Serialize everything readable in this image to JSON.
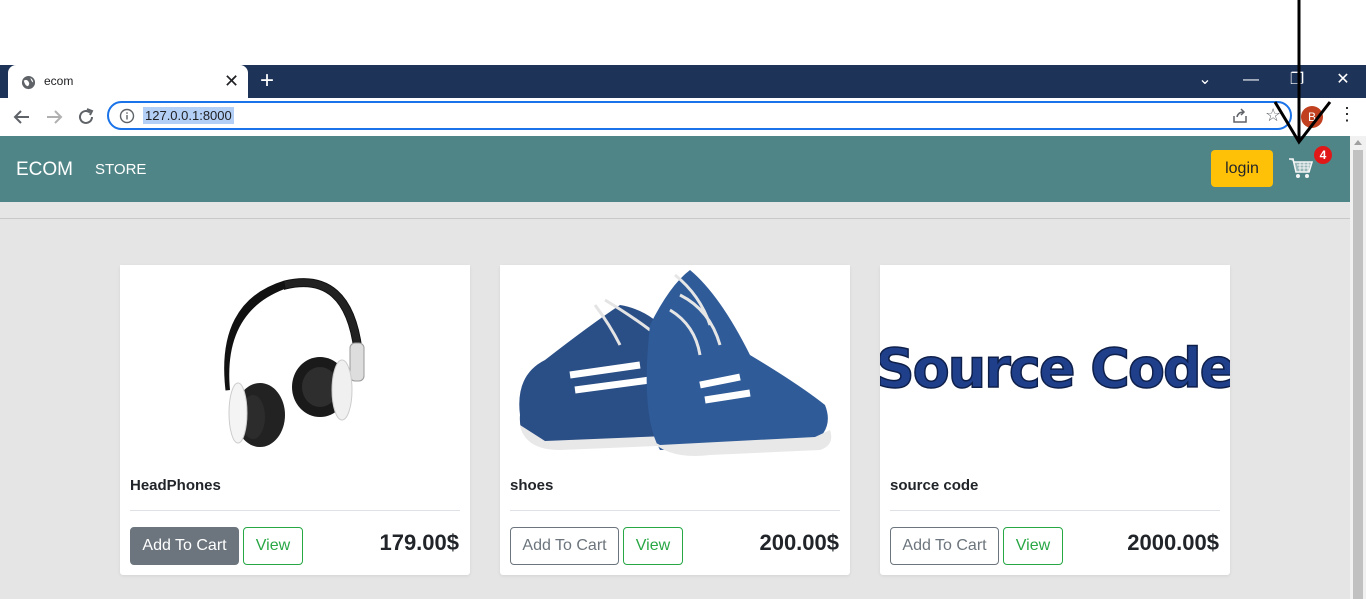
{
  "browser": {
    "tab_title": "ecom",
    "tab_close": "✕",
    "new_tab": "+",
    "url": "127.0.0.1:8000",
    "profile_initial": "B",
    "window_controls": [
      "⌄",
      "—",
      "❐",
      "✕"
    ]
  },
  "navbar": {
    "brand": "ECOM",
    "store_link": "STORE",
    "login_label": "login",
    "cart_count": "4"
  },
  "products": [
    {
      "name": "HeadPhones",
      "add_label": "Add To Cart",
      "view_label": "View",
      "price": "179.00$"
    },
    {
      "name": "shoes",
      "add_label": "Add To Cart",
      "view_label": "View",
      "price": "200.00$"
    },
    {
      "name": "source code",
      "add_label": "Add To Cart",
      "view_label": "View",
      "price": "2000.00$"
    }
  ],
  "image_text": {
    "source_code": "Source Code"
  },
  "colors": {
    "navbar": "#508587",
    "login": "#ffc107",
    "badge": "#e01818",
    "view_outline": "#28a745"
  }
}
